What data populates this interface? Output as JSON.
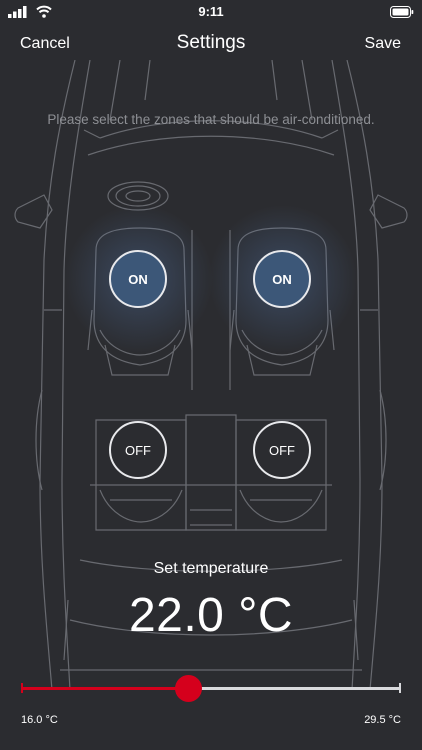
{
  "status_bar": {
    "time": "9:11"
  },
  "nav": {
    "cancel_label": "Cancel",
    "title": "Settings",
    "save_label": "Save"
  },
  "instruction": "Please select the zones that should be air-conditioned.",
  "zones": {
    "front_left": "ON",
    "front_right": "ON",
    "rear_left": "OFF",
    "rear_right": "OFF"
  },
  "temperature": {
    "label": "Set temperature",
    "value": "22.0 °C",
    "min_label": "16.0 °C",
    "max_label": "29.5 °C",
    "level_fraction": 0.44
  },
  "colors": {
    "background": "#2b2c30",
    "accent_red": "#d5001c",
    "zone_on": "#3c5778",
    "outline": "#6e7075"
  }
}
